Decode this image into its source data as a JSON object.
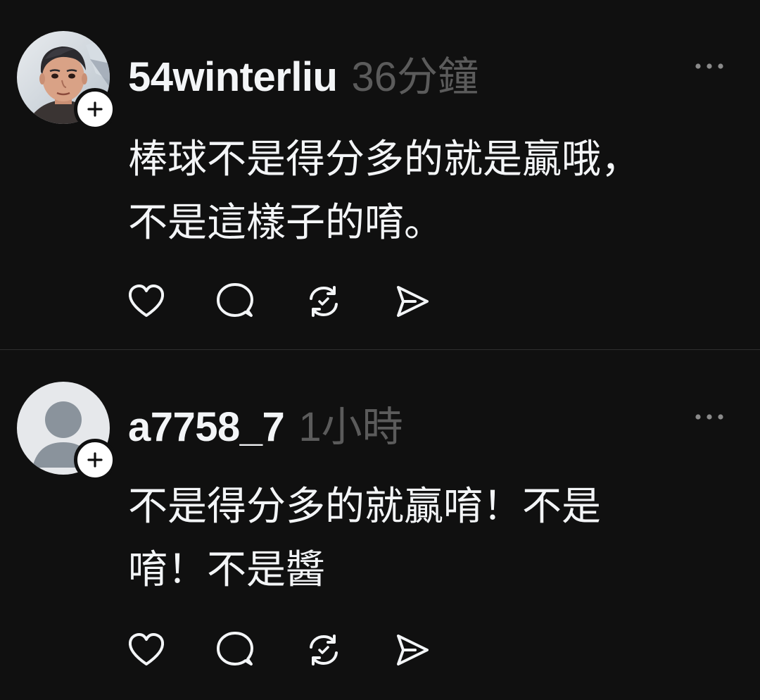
{
  "colors": {
    "background": "#101010",
    "primary_text": "#f3f5f7",
    "secondary_text": "#5b5b5b",
    "divider": "#2f2f2f",
    "icon": "#f3f5f7"
  },
  "posts": [
    {
      "username": "54winterliu",
      "timestamp": "36分鐘",
      "text_lines": [
        "棒球不是得分多的就是贏哦，",
        "不是這樣子的唷。"
      ],
      "avatar_icon": "profile-photo-icon",
      "actions": [
        "heart-icon",
        "comment-icon",
        "repost-icon",
        "share-icon"
      ]
    },
    {
      "username": "a7758_7",
      "timestamp": "1小時",
      "text_lines": [
        "不是得分多的就贏唷！不是",
        "唷！不是醬"
      ],
      "avatar_icon": "default-avatar-icon",
      "actions": [
        "heart-icon",
        "comment-icon",
        "repost-icon",
        "share-icon"
      ]
    }
  ]
}
